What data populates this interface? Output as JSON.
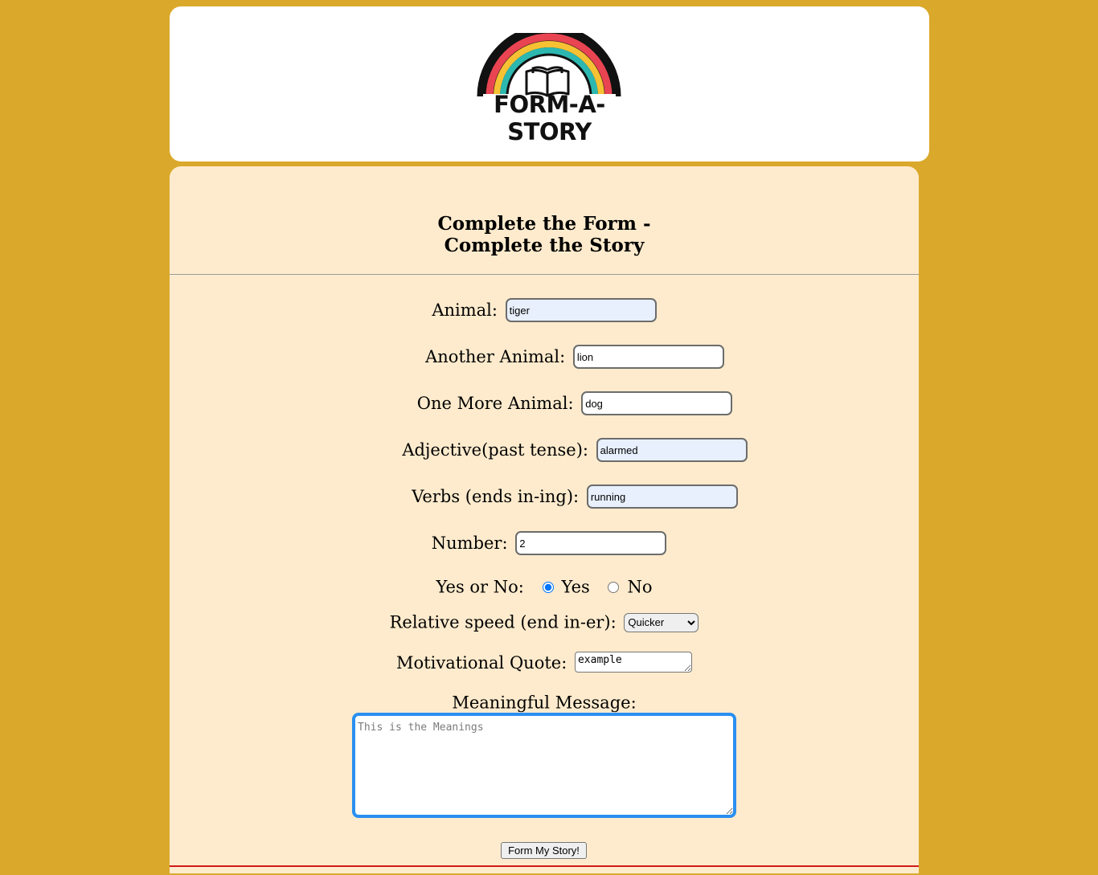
{
  "logo": {
    "text": "FORM-A-STORY"
  },
  "form": {
    "title_line1": "Complete the Form -",
    "title_line2": "Complete the Story",
    "fields": {
      "animal": {
        "label": "Animal:",
        "value": "tiger"
      },
      "another_animal": {
        "label": "Another Animal:",
        "value": "lion"
      },
      "one_more_animal": {
        "label": "One More Animal:",
        "value": "dog"
      },
      "adjective": {
        "label": "Adjective(past tense):",
        "value": "alarmed"
      },
      "verbs": {
        "label": "Verbs (ends in-ing):",
        "value": "running"
      },
      "number": {
        "label": "Number:",
        "value": "2"
      }
    },
    "yes_no": {
      "label": "Yes or No:",
      "yes_label": "Yes",
      "no_label": "No",
      "selected": "Yes"
    },
    "speed": {
      "label": "Relative speed (end in-er):",
      "selected": "Quicker"
    },
    "quote": {
      "label": "Motivational Quote:",
      "value": "example"
    },
    "message": {
      "label": "Meaningful Message:",
      "placeholder": "This is the Meanings"
    },
    "submit_label": "Form My Story!"
  },
  "colors": {
    "page_background": "#daa92b",
    "form_background": "#feebcd",
    "focus_ring": "#2a8ff0",
    "bottom_rule": "#d11a1a"
  }
}
